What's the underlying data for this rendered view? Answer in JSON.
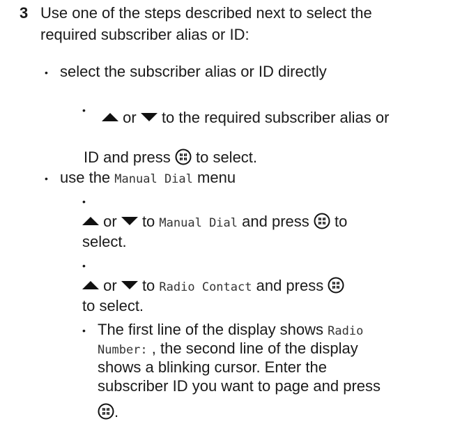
{
  "step": {
    "number": "3",
    "line1": "Use one of the steps described next to select the",
    "line2": "required subscriber alias or ID:"
  },
  "option1": {
    "label": "select the subscriber alias or ID directly",
    "sub": {
      "or": "or",
      "to_text": "to the required subscriber alias or",
      "line2_a": "ID and press",
      "line2_b": "to select."
    }
  },
  "option2": {
    "label_a": "use the",
    "label_menu": "Manual Dial",
    "label_b": "menu",
    "sub1": {
      "or": "or",
      "to": "to",
      "menu": "Manual Dial",
      "press": "and press",
      "tail": "to",
      "line2": "select."
    },
    "sub2": {
      "or": "or",
      "to": "to",
      "menu": "Radio Contact",
      "press": "and press",
      "line2": "to select."
    },
    "sub3": {
      "l1_text": "The first line of the display shows",
      "l1_mono": "Radio",
      "l2_mono": "Number:",
      "l2_text": ", the second line of the display",
      "l3": "shows a blinking cursor. Enter the",
      "l4": "subscriber ID you want to page and press",
      "l5_tail": "."
    }
  },
  "bullet_char": "•",
  "icons": {
    "up": "up-arrow-icon",
    "down": "down-arrow-icon",
    "menu": "menu-ok-button-icon"
  }
}
